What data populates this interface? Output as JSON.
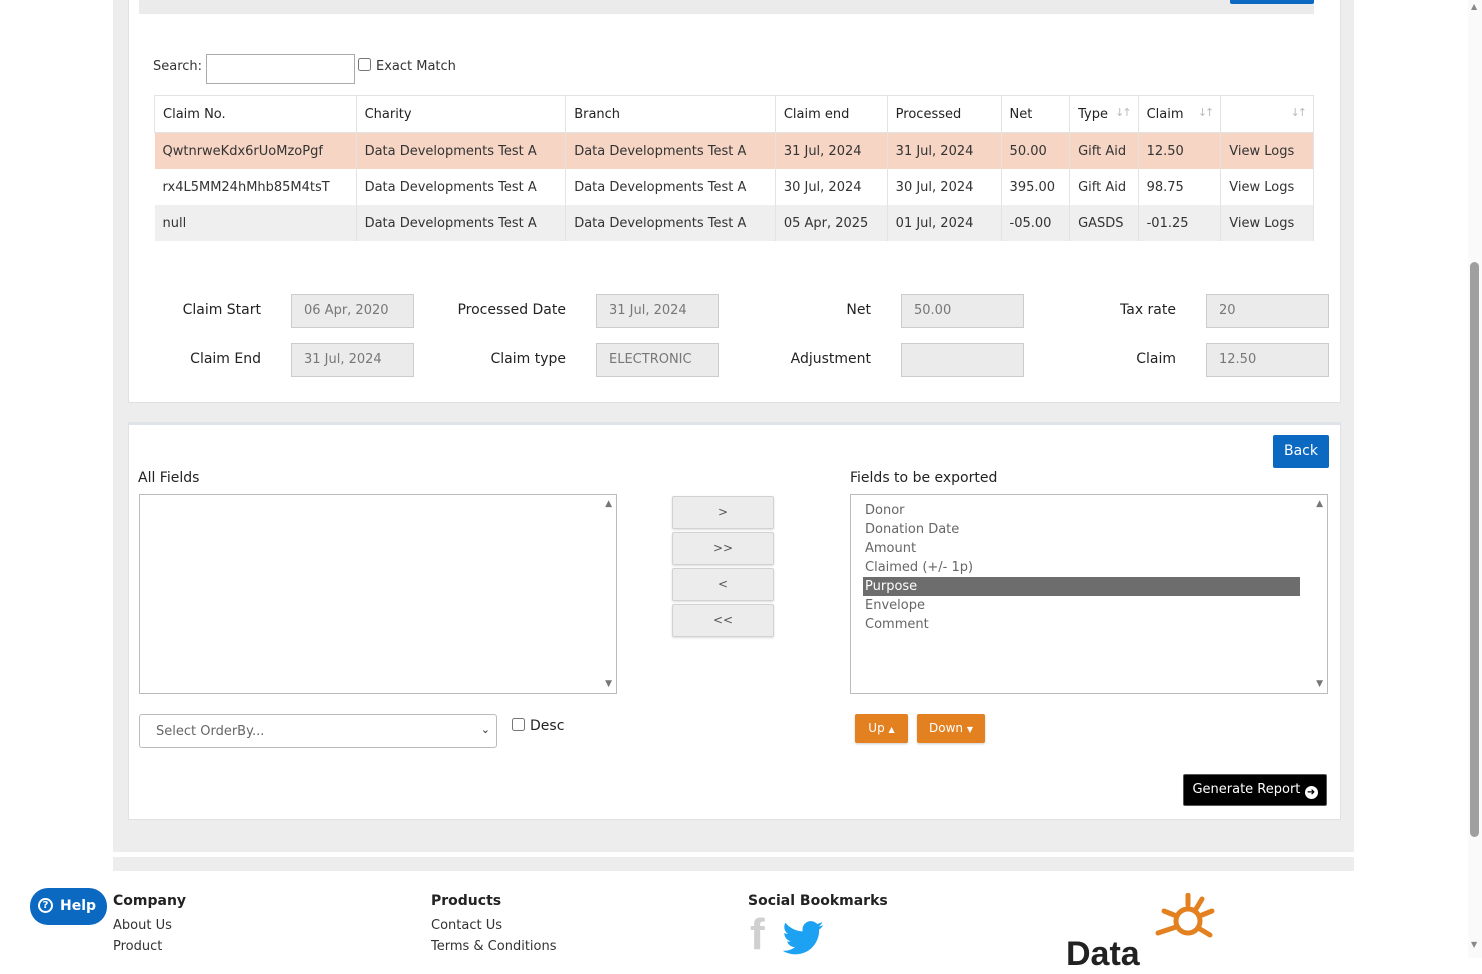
{
  "search": {
    "label": "Search:",
    "exact_match": "Exact Match"
  },
  "table": {
    "headers": [
      "Claim No.",
      "Charity",
      "Branch",
      "Claim end",
      "Processed",
      "Net",
      "Type",
      "Claim",
      ""
    ],
    "rows": [
      [
        "QwtnrweKdx6rUoMzoPgf",
        "Data Developments Test A",
        "Data Developments Test A",
        "31 Jul, 2024",
        "31 Jul, 2024",
        "50.00",
        "Gift Aid",
        "12.50",
        "View Logs"
      ],
      [
        "rx4L5MM24hMhb85M4tsT",
        "Data Developments Test A",
        "Data Developments Test A",
        "30 Jul, 2024",
        "30 Jul, 2024",
        "395.00",
        "Gift Aid",
        "98.75",
        "View Logs"
      ],
      [
        "null",
        "Data Developments Test A",
        "Data Developments Test A",
        "05 Apr, 2025",
        "01 Jul, 2024",
        "-05.00",
        "GASDS",
        "-01.25",
        "View Logs"
      ]
    ]
  },
  "details": {
    "claim_start_label": "Claim Start",
    "claim_start": "06 Apr, 2020",
    "processed_date_label": "Processed Date",
    "processed_date": "31 Jul, 2024",
    "net_label": "Net",
    "net": "50.00",
    "tax_rate_label": "Tax rate",
    "tax_rate": "20",
    "claim_end_label": "Claim End",
    "claim_end": "31 Jul, 2024",
    "claim_type_label": "Claim type",
    "claim_type": "ELECTRONIC",
    "adjustment_label": "Adjustment",
    "adjustment": "",
    "claim_label": "Claim",
    "claim": "12.50"
  },
  "export": {
    "back": "Back",
    "all_fields_label": "All Fields",
    "fields_exported_label": "Fields to be exported",
    "move_buttons": [
      ">",
      ">>",
      "<",
      "<<"
    ],
    "exported_fields": [
      "Donor",
      "Donation Date",
      "Amount",
      "Claimed (+/- 1p)",
      "Purpose",
      "Envelope",
      "Comment"
    ],
    "selected_field": "Purpose",
    "orderby_placeholder": "Select OrderBy...",
    "desc_label": "Desc",
    "up": "Up",
    "down": "Down",
    "generate": "Generate Report"
  },
  "footer": {
    "help": "Help",
    "company_title": "Company",
    "company_links": [
      "About Us",
      "Product"
    ],
    "products_title": "Products",
    "products_links": [
      "Contact Us",
      "Terms & Conditions"
    ],
    "social_title": "Social Bookmarks",
    "logo_text": "Data"
  },
  "colors": {
    "primary": "#0b69c1",
    "orange": "#e3801f",
    "highlight_row": "#f6d5c4"
  }
}
